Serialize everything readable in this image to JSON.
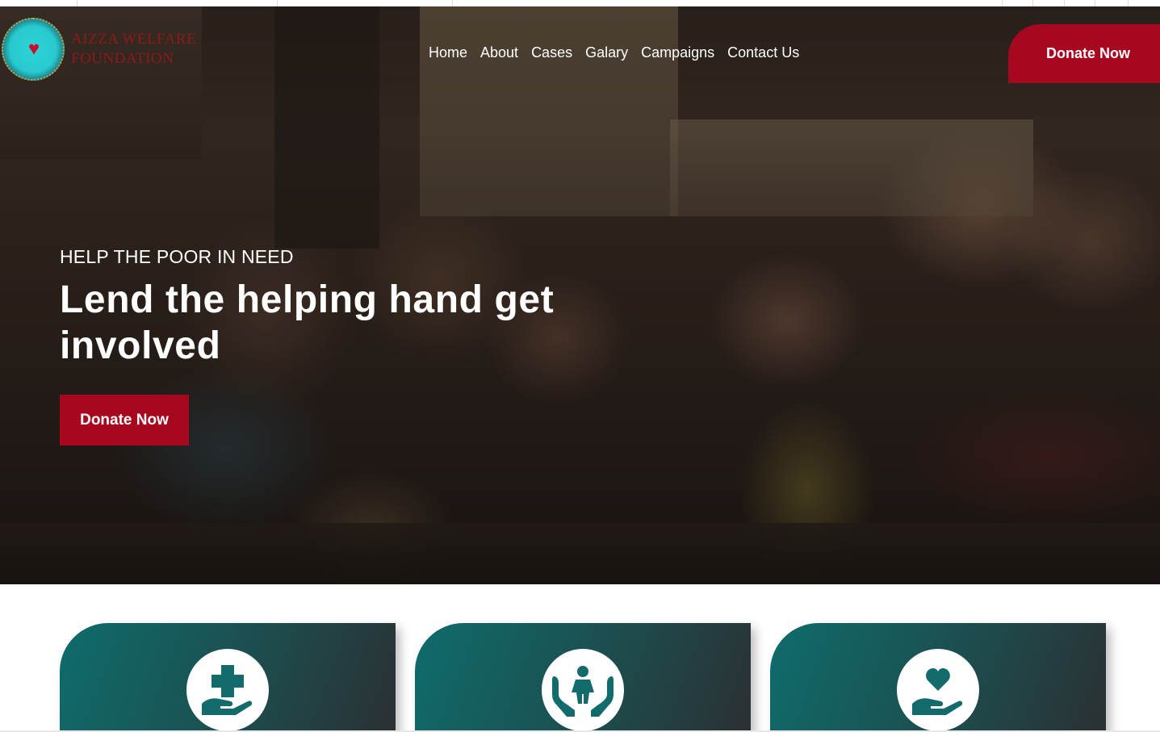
{
  "brand": {
    "name_line1": "AIZZA WELFARE",
    "name_line2": "FOUNDATION"
  },
  "nav": {
    "items": [
      "Home",
      "About",
      "Cases",
      "Galary",
      "Campaigns",
      "Contact Us"
    ]
  },
  "header": {
    "donate_label": "Donate Now"
  },
  "hero": {
    "subtitle": "HELP THE POOR IN NEED",
    "title": "Lend the helping hand get involved",
    "donate_label": "Donate Now"
  },
  "cards": [
    {
      "icon": "medical-hand-icon"
    },
    {
      "icon": "child-care-hands-icon"
    },
    {
      "icon": "heart-hand-icon"
    }
  ],
  "colors": {
    "accent": "#a8081f",
    "card_teal": "#0f6c6c",
    "icon_teal": "#136b6b"
  }
}
